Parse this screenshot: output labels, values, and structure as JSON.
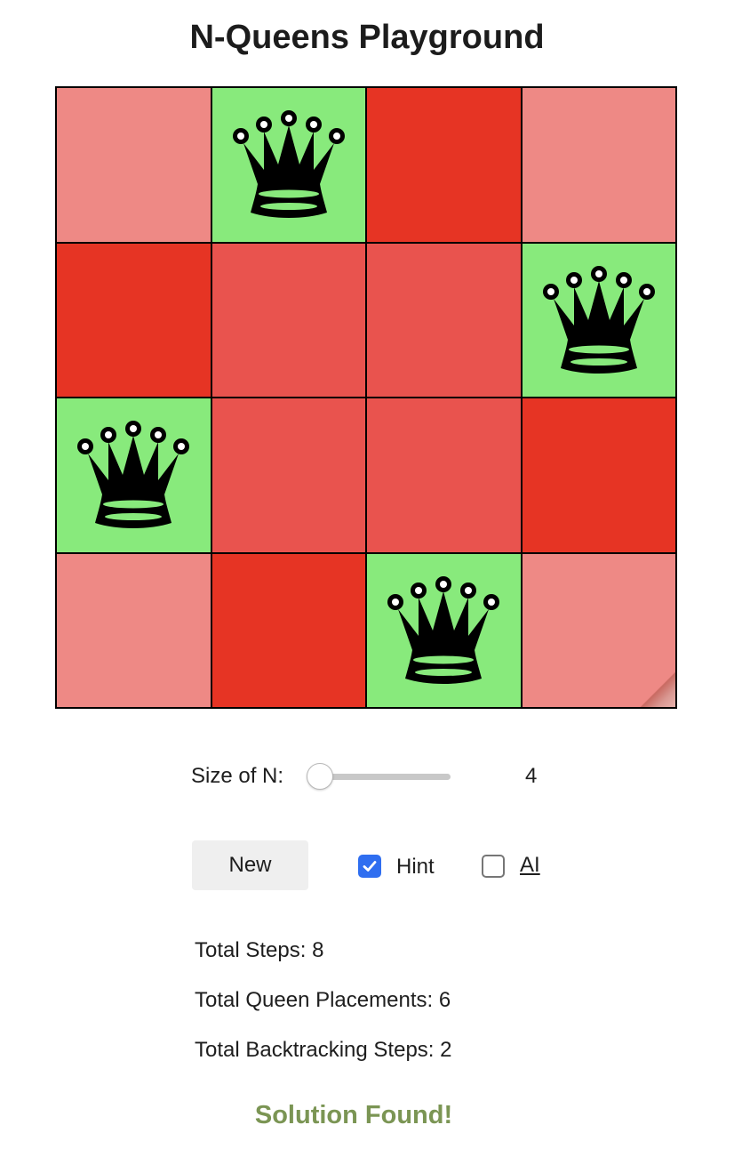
{
  "title": "N-Queens Playground",
  "board": {
    "n": 4,
    "queen_icon": "queen-icon",
    "rows": [
      [
        {
          "shade": "light",
          "queen": false
        },
        {
          "shade": "queen",
          "queen": true
        },
        {
          "shade": "dark",
          "queen": false
        },
        {
          "shade": "light",
          "queen": false
        }
      ],
      [
        {
          "shade": "dark",
          "queen": false
        },
        {
          "shade": "mid",
          "queen": false
        },
        {
          "shade": "mid",
          "queen": false
        },
        {
          "shade": "queen",
          "queen": true
        }
      ],
      [
        {
          "shade": "queen",
          "queen": true
        },
        {
          "shade": "mid",
          "queen": false
        },
        {
          "shade": "mid",
          "queen": false
        },
        {
          "shade": "dark",
          "queen": false
        }
      ],
      [
        {
          "shade": "light",
          "queen": false
        },
        {
          "shade": "dark",
          "queen": false
        },
        {
          "shade": "queen",
          "queen": true
        },
        {
          "shade": "light",
          "queen": false
        }
      ]
    ],
    "colors": {
      "light": "#ee8985",
      "mid": "#e9534e",
      "dark": "#e63424",
      "queen": "#88ea7c"
    }
  },
  "size": {
    "label": "Size of N:",
    "value": "4",
    "slider_fraction": 0
  },
  "controls": {
    "new_label": "New",
    "hint_label": "Hint",
    "hint_checked": true,
    "ai_label": "AI",
    "ai_checked": false
  },
  "stats": {
    "total_steps": "Total Steps: 8",
    "total_placements": "Total Queen Placements: 6",
    "total_backtracking": "Total Backtracking Steps: 2"
  },
  "status": {
    "text": "Solution Found!",
    "color": "#7b9554"
  }
}
